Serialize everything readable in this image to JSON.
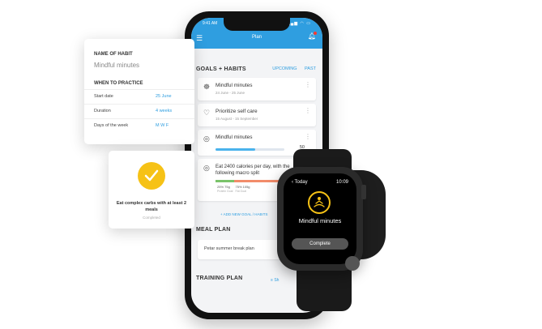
{
  "phone": {
    "status_time": "9:41 AM",
    "status_icons": "▂▄▆ ◠ ▭",
    "title": "Plan",
    "goals_header": "GOALS + HABITS",
    "tabs": [
      "UPCOMING",
      "PAST"
    ],
    "goals": [
      {
        "title": "Mindful minutes",
        "dates": "24 June - 25 June"
      },
      {
        "title": "Prioritize self care",
        "dates": "15 August - 15 September"
      },
      {
        "title": "Mindful minutes",
        "value": "50",
        "progress": 0.58
      },
      {
        "title": "Eat 2400 calories per day, with the following macro split",
        "macros": [
          {
            "label": "25% 75g",
            "sub": "Protein Goal",
            "color": "#7ac36a",
            "share": 0.25
          },
          {
            "label": "75% 105g",
            "sub": "Fat Goal",
            "color": "#f28c6a",
            "share": 0.75
          }
        ]
      }
    ],
    "add_goal_link": "+ ADD NEW GOAL / HABITS",
    "meal_header": "MEAL PLAN",
    "meal_item": "Petar summer break plan",
    "training_header": "TRAINING PLAN",
    "show_label": "Sh"
  },
  "habit_card": {
    "name_label": "NAME OF HABIT",
    "name_value": "Mindful minutes",
    "when_label": "WHEN TO PRACTICE",
    "rows": [
      {
        "key": "Start date",
        "value": "25 June"
      },
      {
        "key": "Duration",
        "value": "4 weeks"
      },
      {
        "key": "Days of the week",
        "value": "M W F"
      }
    ]
  },
  "completed_card": {
    "text": "Eat complex carbs with at least 2 meals",
    "status": "Completed"
  },
  "watch": {
    "back": "‹ Today",
    "time": "10:09",
    "title": "Mindful minutes",
    "button": "Complete"
  },
  "colors": {
    "accent": "#2f9ee0",
    "check": "#f6c216"
  }
}
